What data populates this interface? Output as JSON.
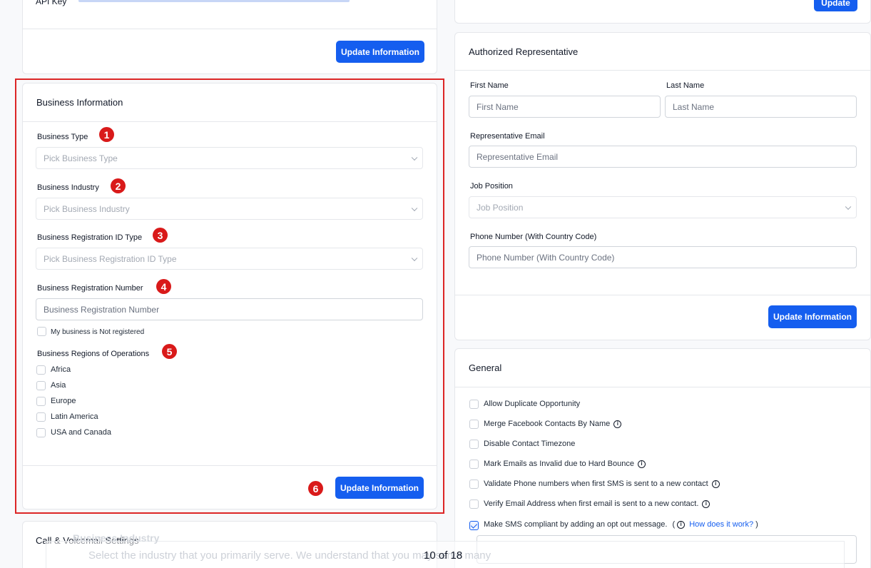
{
  "top_left_card": {
    "api_key_label": "API Key",
    "update_button": "Update Information"
  },
  "top_right_card": {
    "update_button": "Update"
  },
  "business_info": {
    "title": "Business Information",
    "business_type": {
      "label": "Business Type",
      "placeholder": "Pick Business Type",
      "badge": "1"
    },
    "business_industry": {
      "label": "Business Industry",
      "placeholder": "Pick Business Industry",
      "badge": "2"
    },
    "registration_id_type": {
      "label": "Business Registration ID Type",
      "placeholder": "Pick Business Registration ID Type",
      "badge": "3"
    },
    "registration_number": {
      "label": "Business Registration Number",
      "placeholder": "Business Registration Number",
      "badge": "4"
    },
    "not_registered_label": "My business is Not registered",
    "regions": {
      "label": "Business Regions of Operations",
      "badge": "5",
      "options": [
        "Africa",
        "Asia",
        "Europe",
        "Latin America",
        "USA and Canada"
      ]
    },
    "update_button": "Update Information",
    "update_badge": "6"
  },
  "call_voicemail": {
    "title": "Call & Voicemail Settings"
  },
  "authorized_rep": {
    "title": "Authorized Representative",
    "first_name": {
      "label": "First Name",
      "placeholder": "First Name"
    },
    "last_name": {
      "label": "Last Name",
      "placeholder": "Last Name"
    },
    "email": {
      "label": "Representative Email",
      "placeholder": "Representative Email"
    },
    "job_position": {
      "label": "Job Position",
      "placeholder": "Job Position"
    },
    "phone": {
      "label": "Phone Number (With Country Code)",
      "placeholder": "Phone Number (With Country Code)"
    },
    "update_button": "Update Information"
  },
  "general": {
    "title": "General",
    "options": [
      {
        "label": "Allow Duplicate Opportunity",
        "checked": false,
        "info": false
      },
      {
        "label": "Merge Facebook Contacts By Name",
        "checked": false,
        "info": true
      },
      {
        "label": "Disable Contact Timezone",
        "checked": false,
        "info": false
      },
      {
        "label": "Mark Emails as Invalid due to Hard Bounce",
        "checked": false,
        "info": true
      },
      {
        "label": "Validate Phone numbers when first SMS is sent to a new contact",
        "checked": false,
        "info": true
      },
      {
        "label": "Verify Email Address when first email is sent to a new contact.",
        "checked": false,
        "info": true
      },
      {
        "label": "Make SMS compliant by adding an opt out message.",
        "checked": true,
        "info": false
      }
    ],
    "how_link": "How does it work?",
    "paren_open": "(",
    "paren_close": ")",
    "info_glyph": "i"
  },
  "overlay": {
    "page_indicator": "10 of 18",
    "heading": "Business Industry",
    "text": "Select the industry that you primarily serve. We understand that you may serve many"
  },
  "colors": {
    "primary": "#155eef",
    "highlight": "#dc2626",
    "badge": "#d91a1a"
  }
}
